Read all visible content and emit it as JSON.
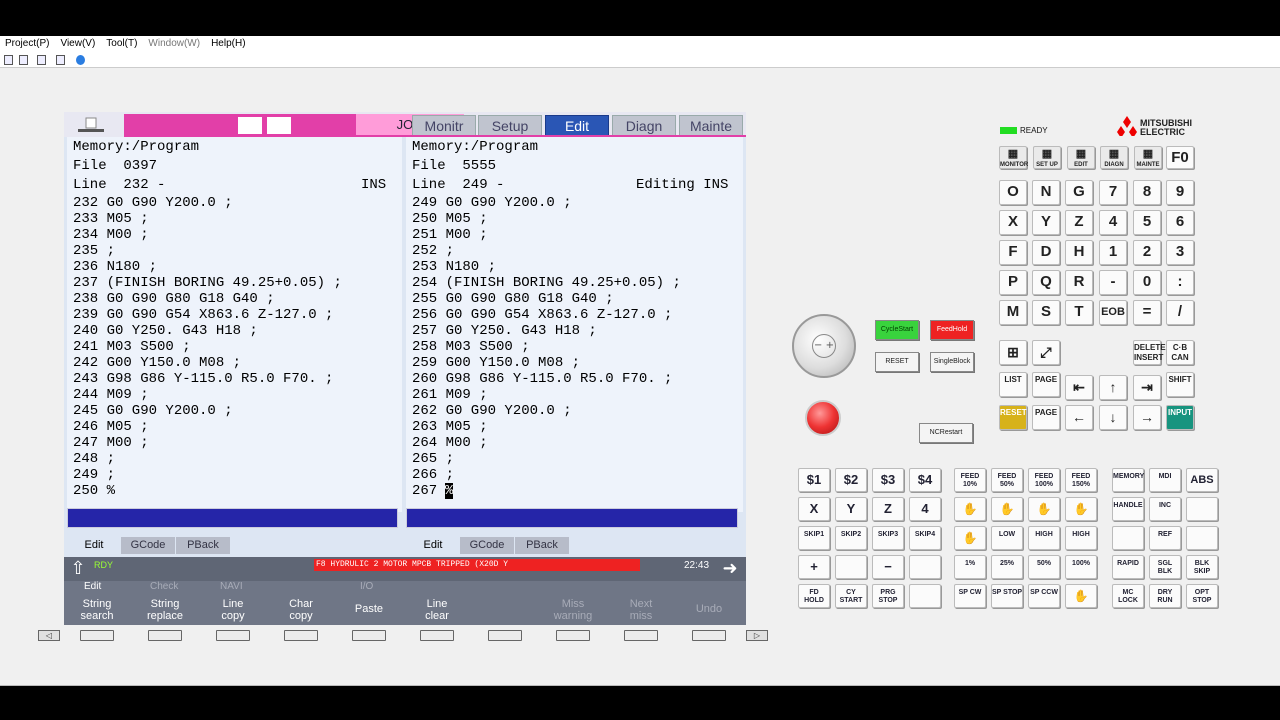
{
  "menubar": [
    "Project(P)",
    "View(V)",
    "Tool(T)",
    "Window(W)",
    "Help(H)"
  ],
  "hmi": {
    "mode": "JOG",
    "tabs": [
      "Monitr",
      "Setup",
      "Edit",
      "Diagn",
      "Mainte"
    ],
    "active_tab": "Edit",
    "left": {
      "memory": "Memory:/Program",
      "file": "File  0397",
      "line": "Line  232 -",
      "status": "INS",
      "code": [
        "232 G0 G90 Y200.0 ;",
        "233 M05 ;",
        "234 M00 ;",
        "235 ;",
        "236 N180 ;",
        "237 (FINISH BORING 49.25+0.05) ;",
        "238 G0 G90 G80 G18 G40 ;",
        "239 G0 G90 G54 X863.6 Z-127.0 ;",
        "240 G0 Y250. G43 H18 ;",
        "241 M03 S500 ;",
        "242 G00 Y150.0 M08 ;",
        "243 G98 G86 Y-115.0 R5.0 F70. ;",
        "244 M09 ;",
        "245 G0 G90 Y200.0 ;",
        "246 M05 ;",
        "247 M00 ;",
        "248 ;",
        "249 ;",
        "250 %"
      ],
      "tabs": [
        "Edit",
        "GCode",
        "PBack"
      ]
    },
    "right": {
      "memory": "Memory:/Program",
      "file": "File  5555",
      "line": "Line  249 -",
      "status": "Editing INS",
      "code": [
        "249 G0 G90 Y200.0 ;",
        "250 M05 ;",
        "251 M00 ;",
        "252 ;",
        "253 N180 ;",
        "254 (FINISH BORING 49.25+0.05) ;",
        "255 G0 G90 G80 G18 G40 ;",
        "256 G0 G90 G54 X863.6 Z-127.0 ;",
        "257 G0 Y250. G43 H18 ;",
        "258 M03 S500 ;",
        "259 G00 Y150.0 M08 ;",
        "260 G98 G86 Y-115.0 R5.0 F70. ;",
        "261 M09 ;",
        "262 G0 G90 Y200.0 ;",
        "263 M05 ;",
        "264 M00 ;",
        "265 ;",
        "266 ;",
        "267 "
      ],
      "caret": "%",
      "tabs": [
        "Edit",
        "GCode",
        "PBack"
      ]
    },
    "status": {
      "rdy": "RDY",
      "alarm": "F8 HYDRULIC 2 MOTOR MPCB TRIPPED (X20D Y",
      "time": "22:43"
    },
    "menu_groups": [
      "Edit",
      "Check",
      "NAVI",
      "I/O"
    ],
    "softkeys": [
      "String\nsearch",
      "String\nreplace",
      "Line\ncopy",
      "Char\ncopy",
      "Paste",
      "Line\nclear",
      "",
      "Miss\nwarning",
      "Next\nmiss",
      "Undo"
    ]
  },
  "panel": {
    "ready": "READY",
    "brand": "MITSUBISHI\nELECTRIC",
    "func_keys": [
      "MONITOR",
      "SET UP",
      "EDIT",
      "DIAGN",
      "MAINTE"
    ],
    "f0": "F0",
    "keypad": [
      [
        "O",
        "N",
        "G",
        "7",
        "8",
        "9"
      ],
      [
        "X",
        "Y",
        "Z",
        "4",
        "5",
        "6"
      ],
      [
        "F",
        "D",
        "H",
        "1",
        "2",
        "3"
      ],
      [
        "P",
        "Q",
        "R",
        "-",
        "0",
        ":"
      ],
      [
        "M",
        "S",
        "T",
        "EOB",
        "=",
        "/"
      ]
    ],
    "keypad_sub": [
      [
        "A",
        "B",
        "C",
        "",
        "",
        ""
      ],
      [
        "U",
        "V",
        "W",
        "",
        "@",
        ""
      ],
      [
        "L",
        "J",
        "K",
        "",
        "<",
        ""
      ],
      [
        "I",
        "J",
        "K",
        "",
        "SP",
        ""
      ],
      [
        "",
        "",
        "",
        "",
        "#",
        ""
      ]
    ],
    "delete_insert": "DELETE\nINSERT",
    "can": "C·B\nCAN",
    "shift": "SHIFT",
    "list": "LIST",
    "page": "PAGE",
    "reset_key": "RESET",
    "input": "INPUT",
    "cycle_start": "CycleStart",
    "feed_hold": "FeedHold",
    "reset": "RESET",
    "single_block": "SingleBlock",
    "nc_restart": "NCRestart",
    "op_rows": [
      [
        "$1",
        "$2",
        "$3",
        "$4"
      ],
      [
        "X",
        "Y",
        "Z",
        "4"
      ],
      [
        "SKIP1",
        "SKIP2",
        "SKIP3",
        "SKIP4"
      ],
      [
        "+",
        "",
        "−",
        ""
      ],
      [
        "FD HOLD",
        "CY START",
        "PRG STOP",
        ""
      ]
    ],
    "feed_rows": [
      [
        "FEED\n10%",
        "FEED\n50%",
        "FEED\n100%",
        "FEED\n150%"
      ],
      [
        "",
        "",
        "",
        ""
      ],
      [
        "",
        "LOW",
        "HIGH",
        "HIGH"
      ],
      [
        "1%",
        "25%",
        "50%",
        "100%"
      ],
      [
        "SP CW",
        "SP STOP",
        "SP CCW",
        ""
      ]
    ],
    "mode_rows": [
      [
        "MEMORY",
        "MDI",
        "ABS"
      ],
      [
        "HANDLE",
        "INC",
        ""
      ],
      [
        "",
        "REF",
        ""
      ],
      [
        "RAPID",
        "SGL BLK",
        "BLK SKIP"
      ],
      [
        "MC LOCK",
        "DRY RUN",
        "OPT STOP"
      ]
    ]
  }
}
